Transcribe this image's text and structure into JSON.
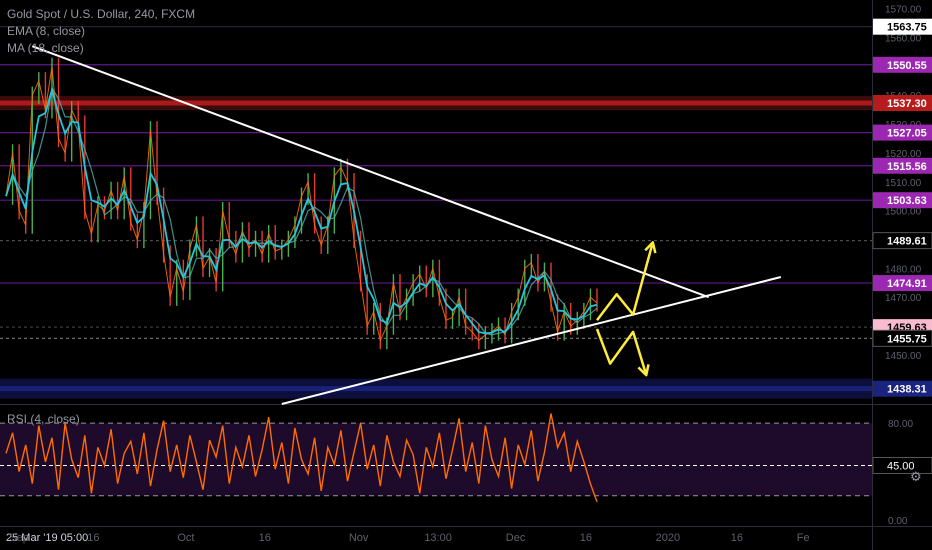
{
  "chart_data": {
    "type": "line",
    "title": "Gold Spot / U.S. Dollar, 240, FXCM",
    "indicators": [
      "EMA (8, close)",
      "MA (18, close)"
    ],
    "price_axis": {
      "range": [
        1433,
        1573
      ],
      "ticks": [
        "1570.00",
        "1560.00",
        "1550.00",
        "1540.00",
        "1530.00",
        "1520.00",
        "1510.00",
        "1500.00",
        "1490.00",
        "1480.00",
        "1470.00",
        "1460.00",
        "1450.00",
        "1440.00"
      ]
    },
    "x_ticks": [
      {
        "label": "25 Mar '19  05:00",
        "t": -1.5
      },
      {
        "label": "Sep",
        "t": 2
      },
      {
        "label": "16",
        "t": 13.3
      },
      {
        "label": "Oct",
        "t": 27.4
      },
      {
        "label": "16",
        "t": 39.4
      },
      {
        "label": "Nov",
        "t": 53.7
      },
      {
        "label": "13:00",
        "t": 65.8
      },
      {
        "label": "Dec",
        "t": 77.6
      },
      {
        "label": "16",
        "t": 88.3
      },
      {
        "label": "2020",
        "t": 100.8
      },
      {
        "label": "16",
        "t": 111.3
      },
      {
        "label": "Fe",
        "t": 121.4
      }
    ],
    "price_levels": [
      {
        "label": "1563.75",
        "price": 1563.75,
        "color": "#2a2e39",
        "tag": "#ffffff",
        "text": "#000000"
      },
      {
        "label": "1550.55",
        "price": 1550.55,
        "color": "#6a1b9a",
        "tag": "#9c27b0",
        "text": "#ffffff"
      },
      {
        "label": "1537.30",
        "price": 1537.3,
        "color": "#b71c1c",
        "tag": "#b71c1c",
        "text": "#ffffff"
      },
      {
        "label": "1527.05",
        "price": 1527.05,
        "color": "#6a1b9a",
        "tag": "#9c27b0",
        "text": "#ffffff"
      },
      {
        "label": "1515.56",
        "price": 1515.56,
        "color": "#6a1b9a",
        "tag": "#9c27b0",
        "text": "#ffffff"
      },
      {
        "label": "1503.63",
        "price": 1503.63,
        "color": "#6a1b9a",
        "tag": "#9c27b0",
        "text": "#ffffff"
      },
      {
        "label": "1489.61",
        "price": 1489.61,
        "color": "#555555",
        "tag": "#000000",
        "text": "#ffffff"
      },
      {
        "label": "1474.91",
        "price": 1474.91,
        "color": "#6a1b9a",
        "tag": "#9c27b0",
        "text": "#ffffff"
      },
      {
        "label": "1459.63",
        "price": 1459.63,
        "color": "#444444",
        "tag": "#f8bbd0",
        "text": "#000000"
      },
      {
        "label": "1455.75",
        "price": 1455.75,
        "color": "#777777",
        "tag": "#000000",
        "text": "#ffffff"
      },
      {
        "label": "1438.31",
        "price": 1438.31,
        "color": "#1a237e",
        "tag": "#1a237e",
        "text": "#ffffff"
      }
    ],
    "trendlines": [
      {
        "name": "resistance",
        "from": [
          4,
          1557
        ],
        "to": [
          107,
          1470
        ]
      },
      {
        "name": "support",
        "from": [
          42,
          1433
        ],
        "to": [
          118,
          1477
        ]
      }
    ],
    "scenario_arrows": [
      {
        "name": "breakout-up",
        "points": [
          [
            90,
            1462
          ],
          [
            93,
            1471
          ],
          [
            95.5,
            1464
          ],
          [
            98.5,
            1489
          ]
        ]
      },
      {
        "name": "breakdown",
        "points": [
          [
            90,
            1459
          ],
          [
            92,
            1447
          ],
          [
            95.5,
            1458
          ],
          [
            97.5,
            1443
          ]
        ]
      }
    ],
    "price_series": {
      "name": "Gold Spot / U.S. Dollar",
      "color": "#ff6d00",
      "t": [
        0,
        1,
        2,
        3,
        4,
        5,
        6,
        7,
        8,
        9,
        10,
        11,
        12,
        13,
        14,
        15,
        16,
        17,
        18,
        19,
        20,
        21,
        22,
        23,
        24,
        25,
        26,
        27,
        28,
        29,
        30,
        31,
        32,
        33,
        34,
        35,
        36,
        37,
        38,
        39,
        40,
        41,
        42,
        43,
        44,
        45,
        46,
        47,
        48,
        49,
        50,
        51,
        52,
        53,
        54,
        55,
        56,
        57,
        58,
        59,
        60,
        61,
        62,
        63,
        64,
        65,
        66,
        67,
        68,
        69,
        70,
        71,
        72,
        73,
        74,
        75,
        76,
        77,
        78,
        79,
        80,
        81,
        82,
        83,
        84,
        85,
        86,
        87,
        88,
        89,
        90
      ],
      "close": [
        1505,
        1520,
        1500,
        1495,
        1540,
        1545,
        1535,
        1550,
        1525,
        1520,
        1535,
        1530,
        1500,
        1492,
        1502,
        1500,
        1507,
        1500,
        1512,
        1496,
        1490,
        1500,
        1528,
        1505,
        1485,
        1470,
        1480,
        1472,
        1487,
        1495,
        1480,
        1484,
        1475,
        1500,
        1490,
        1485,
        1493,
        1487,
        1490,
        1485,
        1492,
        1486,
        1487,
        1490,
        1495,
        1505,
        1510,
        1495,
        1488,
        1495,
        1512,
        1515,
        1510,
        1490,
        1475,
        1460,
        1465,
        1455,
        1460,
        1475,
        1465,
        1470,
        1475,
        1478,
        1473,
        1480,
        1470,
        1462,
        1463,
        1470,
        1460,
        1458,
        1455,
        1457,
        1458,
        1460,
        1457,
        1465,
        1470,
        1480,
        1482,
        1475,
        1479,
        1468,
        1458,
        1465,
        1460,
        1462,
        1465,
        1470,
        1468
      ]
    },
    "ema": {
      "name": "EMA (8, close)",
      "color": "#26c6da"
    },
    "ma": {
      "name": "MA (18, close)",
      "color": "#4db6ac"
    },
    "rsi": {
      "name": "RSI (4, close)",
      "color": "#ff6d00",
      "range": [
        -5,
        95
      ],
      "ticks": [
        "80.00",
        "0.00"
      ],
      "current": "45.00",
      "band": [
        20,
        80
      ],
      "midline": 45,
      "values": [
        55,
        72,
        40,
        62,
        30,
        78,
        48,
        68,
        25,
        80,
        50,
        35,
        70,
        22,
        60,
        45,
        75,
        30,
        55,
        65,
        38,
        72,
        28,
        58,
        82,
        40,
        62,
        35,
        70,
        48,
        25,
        66,
        52,
        78,
        30,
        60,
        44,
        70,
        36,
        58,
        85,
        42,
        64,
        30,
        76,
        50,
        38,
        68,
        24,
        60,
        46,
        74,
        32,
        56,
        80,
        42,
        62,
        28,
        70,
        48,
        36,
        66,
        54,
        22,
        60,
        44,
        72,
        34,
        58,
        84,
        40,
        64,
        30,
        78,
        50,
        36,
        68,
        26,
        62,
        46,
        74,
        32,
        56,
        88,
        60,
        72,
        40,
        65,
        48,
        30,
        15
      ]
    }
  }
}
